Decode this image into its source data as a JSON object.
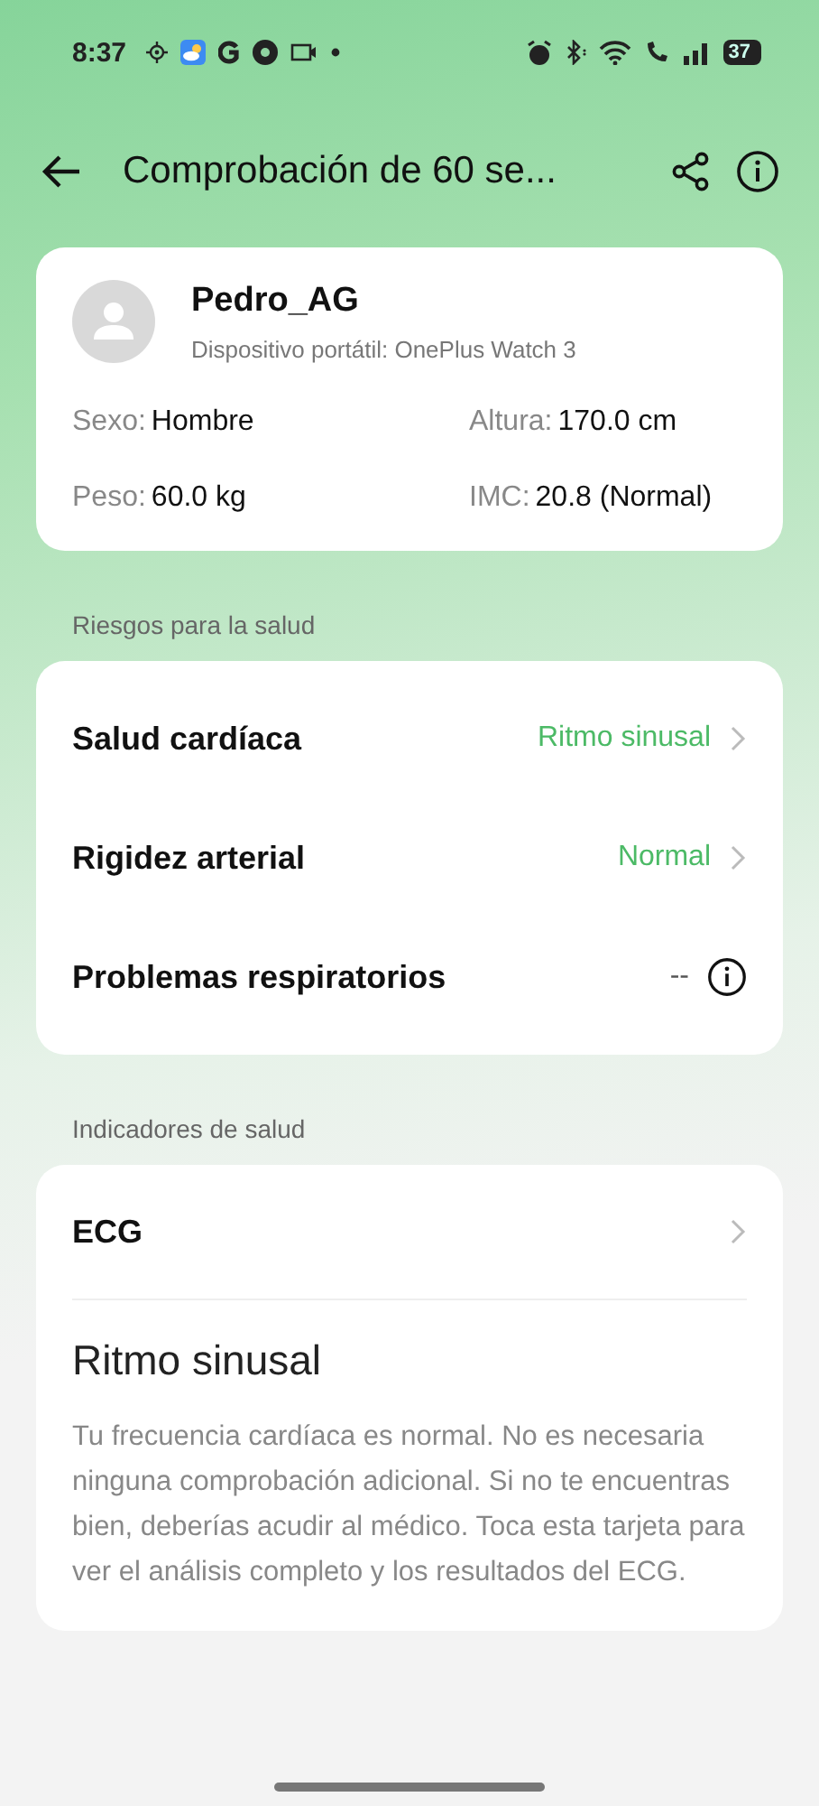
{
  "status_bar": {
    "time": "8:37",
    "battery": "37"
  },
  "header": {
    "title": "Comprobación de 60 se..."
  },
  "profile": {
    "name": "Pedro_AG",
    "device": "Dispositivo portátil: OnePlus Watch 3",
    "stats": [
      {
        "label": "Sexo:",
        "value": "Hombre"
      },
      {
        "label": "Altura:",
        "value": "170.0 cm"
      },
      {
        "label": "Peso:",
        "value": "60.0 kg"
      },
      {
        "label": "IMC:",
        "value": "20.8 (Normal)"
      }
    ]
  },
  "risks": {
    "heading": "Riesgos para la salud",
    "items": [
      {
        "kind": "link",
        "label": "Salud cardíaca",
        "value": "Ritmo sinusal"
      },
      {
        "kind": "link",
        "label": "Rigidez arterial",
        "value": "Normal"
      },
      {
        "kind": "info",
        "label": "Problemas respiratorios",
        "value": "--"
      }
    ]
  },
  "indicators": {
    "heading": "Indicadores de salud",
    "item": {
      "label": "ECG",
      "result": "Ritmo sinusal",
      "description": "Tu frecuencia cardíaca es normal. No es necesaria ninguna comprobación adicional. Si no te encuentras bien, deberías acudir al médico. Toca esta tarjeta para ver el análisis completo y los resultados del ECG."
    }
  }
}
